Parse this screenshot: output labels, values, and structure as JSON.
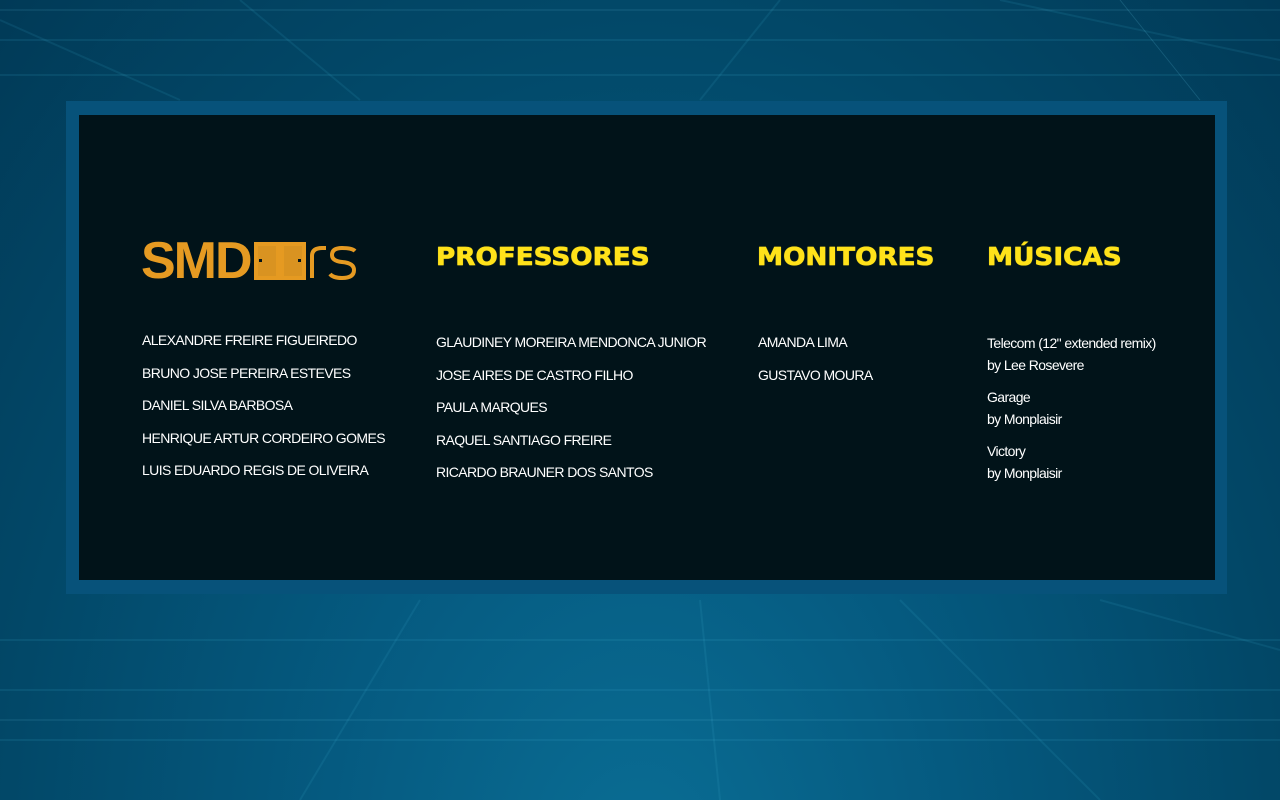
{
  "logo": {
    "text": "SMD",
    "icon_name": "doors-logo-icon",
    "color": "#e59a22"
  },
  "colors": {
    "title": "#ffe21a",
    "panel_bg": "#011319",
    "frame": "#07527a",
    "background": "#024868"
  },
  "columns": {
    "team": {
      "members": [
        "ALEXANDRE FREIRE FIGUEIREDO",
        "BRUNO JOSE PEREIRA ESTEVES",
        "DANIEL SILVA BARBOSA",
        "HENRIQUE ARTUR CORDEIRO GOMES",
        "LUIS EDUARDO REGIS DE OLIVEIRA"
      ]
    },
    "professores": {
      "title": "PROFESSORES",
      "members": [
        "GLAUDINEY MOREIRA MENDONCA JUNIOR",
        "JOSE AIRES DE CASTRO FILHO",
        "PAULA MARQUES",
        "RAQUEL SANTIAGO FREIRE",
        "RICARDO BRAUNER DOS SANTOS"
      ]
    },
    "monitores": {
      "title": "MONITORES",
      "members": [
        "AMANDA LIMA",
        "GUSTAVO MOURA"
      ]
    },
    "musicas": {
      "title": "MÚSICAS",
      "tracks": [
        {
          "title": "Telecom (12\" extended remix)",
          "artist": "by Lee Rosevere"
        },
        {
          "title": "Garage",
          "artist": "by Monplaisir"
        },
        {
          "title": "Victory",
          "artist": "by Monplaisir"
        }
      ]
    }
  }
}
